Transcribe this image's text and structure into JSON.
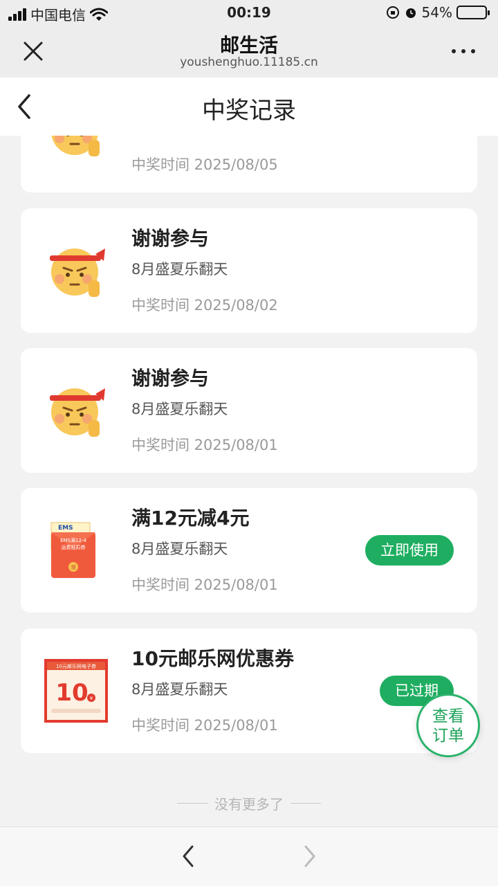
{
  "status_bar": {
    "carrier": "中国电信",
    "time": "00:19",
    "battery": "54%",
    "battery_level": 0.54
  },
  "browser": {
    "title": "邮生活",
    "url": "youshenghuo.11185.cn"
  },
  "header": {
    "title": "中奖记录"
  },
  "records": [
    {
      "name": "",
      "activity": "",
      "time": "中奖时间 2025/08/05",
      "icon": "emoji-face-icon",
      "action": ""
    },
    {
      "name": "谢谢参与",
      "activity": "8月盛夏乐翻天",
      "time": "中奖时间 2025/08/02",
      "icon": "emoji-face-icon",
      "action": ""
    },
    {
      "name": "谢谢参与",
      "activity": "8月盛夏乐翻天",
      "time": "中奖时间 2025/08/01",
      "icon": "emoji-face-icon",
      "action": ""
    },
    {
      "name": "满12元减4元",
      "activity": "8月盛夏乐翻天",
      "time": "中奖时间 2025/08/01",
      "icon": "ems-coupon-envelope-icon",
      "action": "立即使用"
    },
    {
      "name": "10元邮乐网优惠券",
      "activity": "8月盛夏乐翻天",
      "time": "中奖时间 2025/08/01",
      "icon": "ule-coupon-icon",
      "action": "已过期"
    }
  ],
  "ems_coupon_text": {
    "brand": "EMS",
    "line1": "EMS满12-4",
    "line2": "运费抵扣券",
    "seal": "领"
  },
  "ule_coupon_text": {
    "header": "10元邮乐网电子券",
    "amount": "10",
    "unit": "¥"
  },
  "footer_text": "没有更多了",
  "float_button": {
    "line1": "查看",
    "line2": "订单"
  },
  "colors": {
    "accent": "#1fae61",
    "background": "#f2f2f2",
    "card": "#ffffff"
  }
}
